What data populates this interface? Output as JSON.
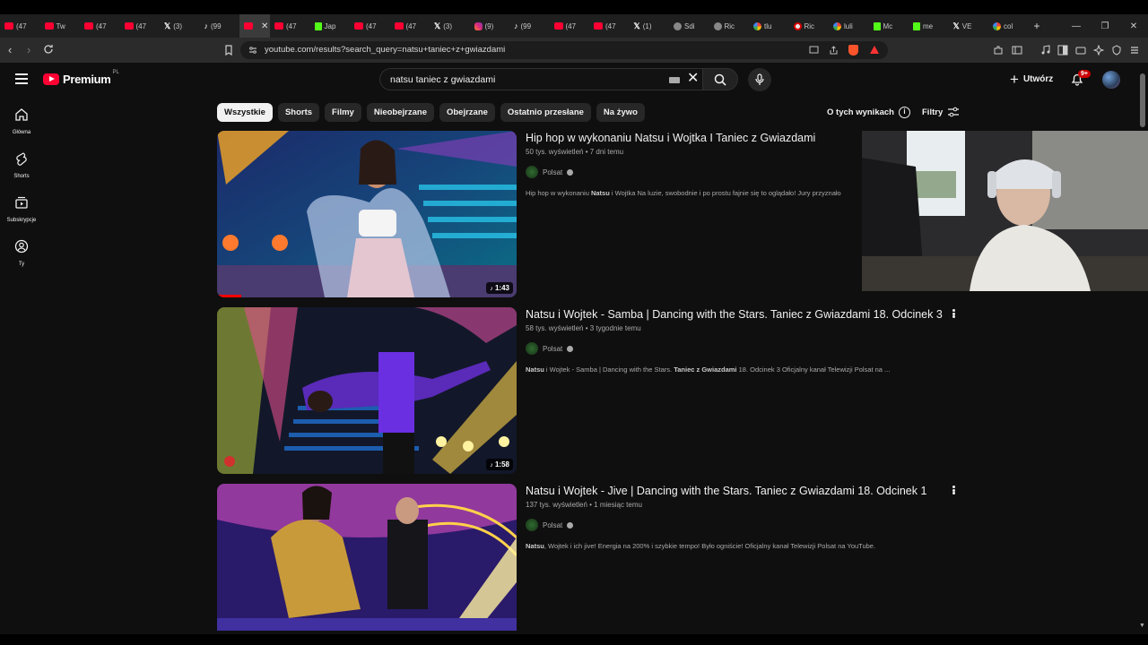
{
  "browser": {
    "tabs": [
      {
        "icon": "youtube-icon",
        "label": "(47"
      },
      {
        "icon": "twitch-icon",
        "label": "Tw"
      },
      {
        "icon": "youtube-icon",
        "label": "(47"
      },
      {
        "icon": "youtube-icon",
        "label": "(47"
      },
      {
        "icon": "x-icon",
        "label": "(3)"
      },
      {
        "icon": "tiktok-icon",
        "label": "(99"
      },
      {
        "icon": "youtube-icon",
        "label": "",
        "active": true
      },
      {
        "icon": "youtube-icon",
        "label": "(47"
      },
      {
        "icon": "kick-icon",
        "label": "Jap"
      },
      {
        "icon": "youtube-icon",
        "label": "(47"
      },
      {
        "icon": "youtube-icon",
        "label": "(47"
      },
      {
        "icon": "x-icon",
        "label": "(3)"
      },
      {
        "icon": "instagram-icon",
        "label": "(9)"
      },
      {
        "icon": "tiktok-icon",
        "label": "(99"
      },
      {
        "icon": "youtube-icon",
        "label": "(47"
      },
      {
        "icon": "youtube-icon",
        "label": "(47"
      },
      {
        "icon": "x-icon",
        "label": "(1)"
      },
      {
        "icon": "globe-icon",
        "label": "Sdi"
      },
      {
        "icon": "chat-icon",
        "label": "Ric"
      },
      {
        "icon": "google-icon",
        "label": "tlu"
      },
      {
        "icon": "record-icon",
        "label": "Ric"
      },
      {
        "icon": "google-icon",
        "label": "luli"
      },
      {
        "icon": "m-icon",
        "label": "Mc"
      },
      {
        "icon": "kick-icon",
        "label": "me"
      },
      {
        "icon": "x-icon",
        "label": "VE"
      },
      {
        "icon": "google-icon",
        "label": "col"
      }
    ],
    "new_tab": "+",
    "url": "youtube.com/results?search_query=natsu+taniec+z+gwiazdami"
  },
  "youtube": {
    "logo_text": "Premium",
    "logo_region": "PL",
    "search_value": "natsu taniec z gwiazdami",
    "create_label": "Utwórz",
    "notif_badge": "9+",
    "sidebar": [
      {
        "icon": "home-icon",
        "label": "Główna"
      },
      {
        "icon": "shorts-icon",
        "label": "Shorts"
      },
      {
        "icon": "subscriptions-icon",
        "label": "Subskrypcje"
      },
      {
        "icon": "you-icon",
        "label": "Ty"
      }
    ],
    "chips": [
      "Wszystkie",
      "Shorts",
      "Filmy",
      "Nieobejrzane",
      "Obejrzane",
      "Ostatnio przesłane",
      "Na żywo"
    ],
    "about_label": "O tych wynikach",
    "filters_label": "Filtry",
    "results": [
      {
        "title": "Hip hop w wykonaniu Natsu i Wojtka I Taniec z Gwiazdami",
        "meta": "50 tys. wyświetleń • 7 dni temu",
        "channel": "Polsat",
        "desc_bold": "Natsu",
        "desc_pre": "Hip hop w wykonaniu ",
        "desc_post": " i Wojtka Na luzie, swobodnie i po prostu fajnie się to oglądało! Jury przyznało",
        "duration": "1:43",
        "progress": 0.08
      },
      {
        "title": "Natsu i Wojtek - Samba | Dancing with the Stars. Taniec z Gwiazdami 18. Odcinek 3",
        "meta": "58 tys. wyświetleń • 3 tygodnie temu",
        "channel": "Polsat",
        "desc_bold": "Natsu",
        "desc_pre": "",
        "desc_mid": " i Wojtek - Samba | Dancing with the Stars. ",
        "desc_bold2": "Taniec z Gwiazdami",
        "desc_post": " 18. Odcinek 3 Oficjalny kanał Telewizji Polsat na ...",
        "duration": "1:58"
      },
      {
        "title": "Natsu i Wojtek - Jive | Dancing with the Stars. Taniec z Gwiazdami 18. Odcinek 1",
        "meta": "137 tys. wyświetleń • 1 miesiąc temu",
        "channel": "Polsat",
        "desc_bold": "Natsu",
        "desc_pre": "",
        "desc_post": ", Wojtek i ich jive! Energia na 200% i szybkie tempo! Było ogniście! Oficjalny kanał Telewizji Polsat na YouTube.",
        "duration": ""
      }
    ]
  },
  "colors": {
    "accent": "#ff0033",
    "bg": "#0f0f0f",
    "chip_active": "#f1f1f1"
  }
}
